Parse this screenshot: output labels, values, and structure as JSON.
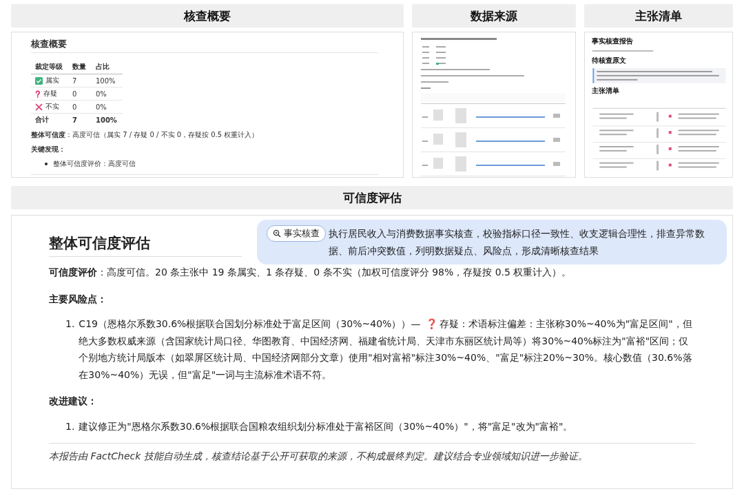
{
  "summary_panel": {
    "header": "核查概要",
    "heading": "核查概要",
    "table": {
      "columns": [
        "裁定等级",
        "数量",
        "占比"
      ],
      "rows": [
        {
          "kind": "true",
          "label": "属实",
          "count": "7",
          "share": "100%"
        },
        {
          "kind": "doubtful",
          "label": "存疑",
          "count": "0",
          "share": "0%"
        },
        {
          "kind": "false",
          "label": "不实",
          "count": "0",
          "share": "0%"
        }
      ],
      "total": {
        "label": "合计",
        "count": "7",
        "share": "100%"
      }
    },
    "overall": "**整体可信度**：高度可信（属实 7 / 存疑 0 / 不实 0，存疑按 0.5 权重计入）",
    "findings_heading": "关键发现：",
    "findings": [
      "整体可信度评价：高度可信"
    ]
  },
  "sources_panel": {
    "header": "数据来源"
  },
  "claims_panel": {
    "header": "主张清单",
    "headings": [
      "事实核查报告",
      "待核查原文",
      "主张清单"
    ]
  },
  "assessment": {
    "header": "可信度评估",
    "heading": "整体可信度评估",
    "rating": "**可信度评价**：高度可信。20 条主张中 19 条属实、1 条存疑、0 条不实（加权可信度评分 98%，存疑按 0.5 权重计入）。",
    "risks_heading": "主要风险点：",
    "risks": [
      {
        "number": "1.",
        "before": "C19（恩格尔系数30.6%根据联合国划分标准处于富足区间（30%~40%））— ",
        "marker": "❓",
        "after": "存疑：术语标注偏差：主张称30%~40%为\"富足区间\"，但绝大多数权威来源（含国家统计局口径、华图教育、中国经济网、福建省统计局、天津市东丽区统计局等）将30%~40%标注为\"富裕\"区间；仅个别地方统计局版本（如翠屏区统计局、中国经济网部分文章）使用\"相对富裕\"标注30%~40%、\"富足\"标注20%~30%。核心数值（30.6%落在30%~40%）无误，但\"富足\"一词与主流标准术语不符。"
      }
    ],
    "suggestions_heading": "改进建议：",
    "suggestions": [
      {
        "number": "1.",
        "text": "建议修正为\"恩格尔系数30.6%根据联合国粮农组织划分标准处于富裕区间（30%~40%）\"，将\"富足\"改为\"富裕\"。"
      }
    ],
    "footer": "本报告由 FactCheck 技能自动生成，核查结论基于公开可获取的来源，不构成最终判定。建议结合专业领域知识进一步验证。"
  },
  "tooltip": {
    "chip": "事实核查",
    "text": "执行居民收入与消费数据事实核查，校验指标口径一致性、收支逻辑合理性，排查异常数据、前后冲突数值，列明数据疑点、风险点，形成清晰核查结果"
  }
}
